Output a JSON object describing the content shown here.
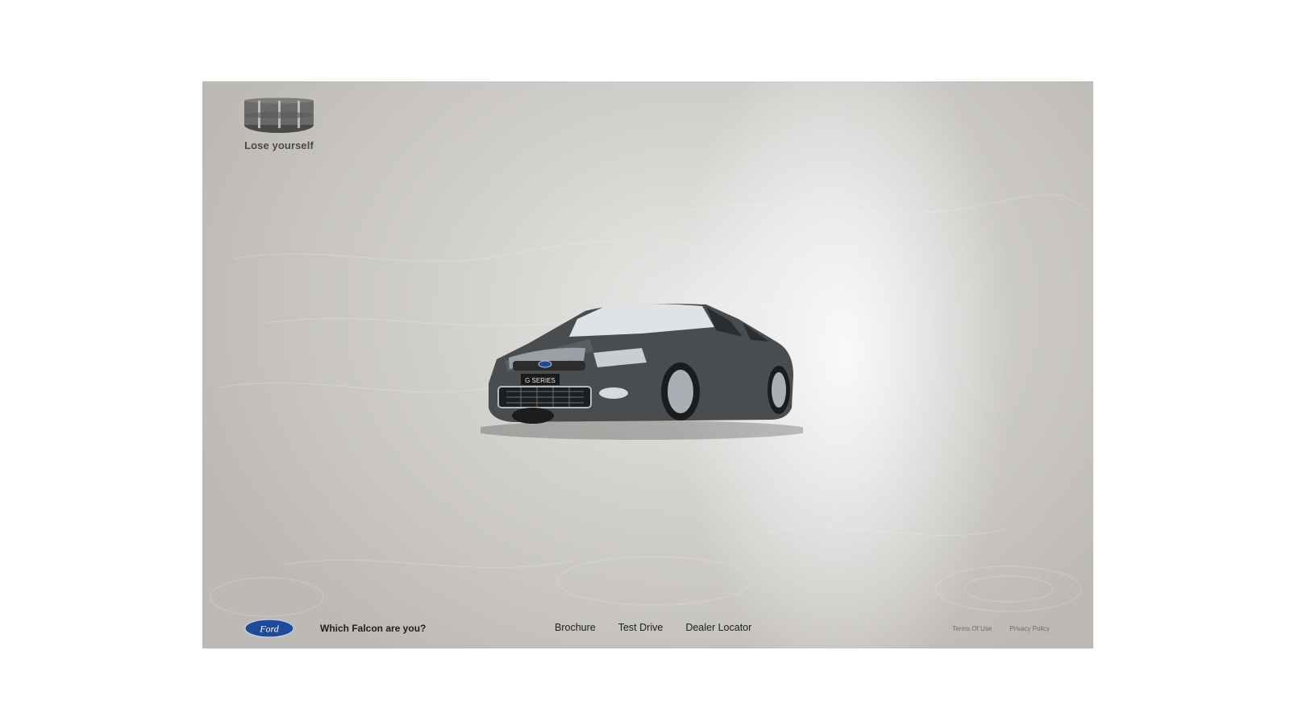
{
  "brand": {
    "tagline": "Lose yourself",
    "logo_icon": "falcon-ring-logo-icon",
    "ford_logo_text": "Ford"
  },
  "hero": {
    "plate_text": "G SERIES",
    "car_color": "#4a4d50"
  },
  "footer": {
    "question": "Which Falcon are you?",
    "nav": [
      {
        "label": "Brochure"
      },
      {
        "label": "Test Drive"
      },
      {
        "label": "Dealer Locator"
      }
    ],
    "legal": [
      {
        "label": "Terms Of Use"
      },
      {
        "label": "Privacy Policy"
      }
    ]
  },
  "colors": {
    "ford_blue": "#1d4a9a",
    "text_dark": "#1e1e1e",
    "background": "#d3d1ce"
  }
}
